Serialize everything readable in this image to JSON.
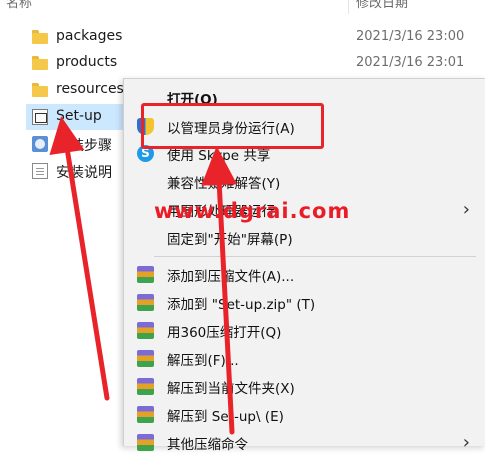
{
  "columns": {
    "name": "名称",
    "date": "修改日期"
  },
  "files": [
    {
      "name": "packages",
      "date": "2021/3/16 23:00",
      "icon": "folder-icon"
    },
    {
      "name": "products",
      "date": "2021/3/16 23:01",
      "icon": "folder-icon"
    },
    {
      "name": "resources",
      "date": "",
      "icon": "folder-icon"
    },
    {
      "name": "Set-up",
      "date": "",
      "icon": "exe-icon",
      "selected": true
    },
    {
      "name": "安装步骤",
      "date": "",
      "icon": "setup-icon"
    },
    {
      "name": "安装说明",
      "date": "",
      "icon": "text-file-icon"
    }
  ],
  "menu": {
    "open": "打开(O)",
    "run_as_admin": "以管理员身份运行(A)",
    "skype_share": "使用 Skype 共享",
    "compat": "兼容性疑难解答(Y)",
    "gpu_run": "用图形处理器运行",
    "pin_start": "固定到\"开始\"屏幕(P)",
    "add_archive": "添加到压缩文件(A)...",
    "add_zip": "添加到 \"Set-up.zip\" (T)",
    "open_360": "用360压缩打开(Q)",
    "extract_to": "解压到(F)...",
    "extract_here": "解压到当前文件夹(X)",
    "extract_setup": "解压到 Set-up\\ (E)",
    "more": "其他压缩命令"
  },
  "annotation": {
    "watermark": "www.dgrai.com",
    "highlight_color": "#e8242a"
  },
  "colors": {
    "selection": "#cce8ff",
    "menu_bg": "#f2f2f2",
    "arrow": "#e8242a"
  }
}
